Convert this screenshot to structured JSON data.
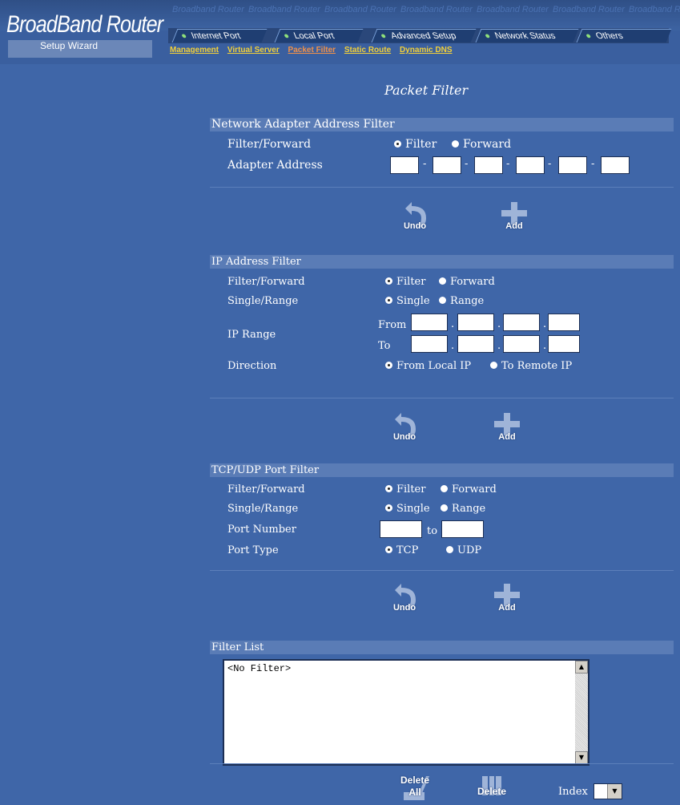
{
  "header": {
    "brand": "BroadBand Router",
    "watermark": "Broadband Router",
    "wizard": "Setup Wizard",
    "tabs": [
      {
        "label": "Internet Port"
      },
      {
        "label": "Local Port"
      },
      {
        "label": "Advanced Setup"
      },
      {
        "label": "Network Status"
      },
      {
        "label": "Others"
      }
    ],
    "sublinks": [
      {
        "label": "Management",
        "active": false
      },
      {
        "label": "Virtual Server",
        "active": false
      },
      {
        "label": "Packet Filter",
        "active": true
      },
      {
        "label": "Static Route",
        "active": false
      },
      {
        "label": "Dynamic DNS",
        "active": false
      }
    ]
  },
  "page_title": "Packet Filter",
  "adapter": {
    "title": "Network Adapter Address Filter",
    "filter_forward_label": "Filter/Forward",
    "opt_filter": "Filter",
    "opt_forward": "Forward",
    "address_label": "Adapter Address",
    "sep": "-"
  },
  "ip": {
    "title": "IP Address Filter",
    "filter_forward_label": "Filter/Forward",
    "opt_filter": "Filter",
    "opt_forward": "Forward",
    "single_range_label": "Single/Range",
    "opt_single": "Single",
    "opt_range": "Range",
    "range_label": "IP Range",
    "from_label": "From",
    "to_label": "To",
    "dot": ".",
    "direction_label": "Direction",
    "opt_from_local": "From Local IP",
    "opt_to_remote": "To Remote IP"
  },
  "port": {
    "title": "TCP/UDP Port Filter",
    "filter_forward_label": "Filter/Forward",
    "opt_filter": "Filter",
    "opt_forward": "Forward",
    "single_range_label": "Single/Range",
    "opt_single": "Single",
    "opt_range": "Range",
    "port_number_label": "Port Number",
    "to_label": "to",
    "port_type_label": "Port Type",
    "opt_tcp": "TCP",
    "opt_udp": "UDP"
  },
  "buttons": {
    "undo": "Undo",
    "add": "Add",
    "delete_all_1": "Delete",
    "delete_all_2": "All",
    "delete": "Delete"
  },
  "filter_list": {
    "title": "Filter List",
    "empty_item": "<No Filter>",
    "index_label": "Index"
  }
}
